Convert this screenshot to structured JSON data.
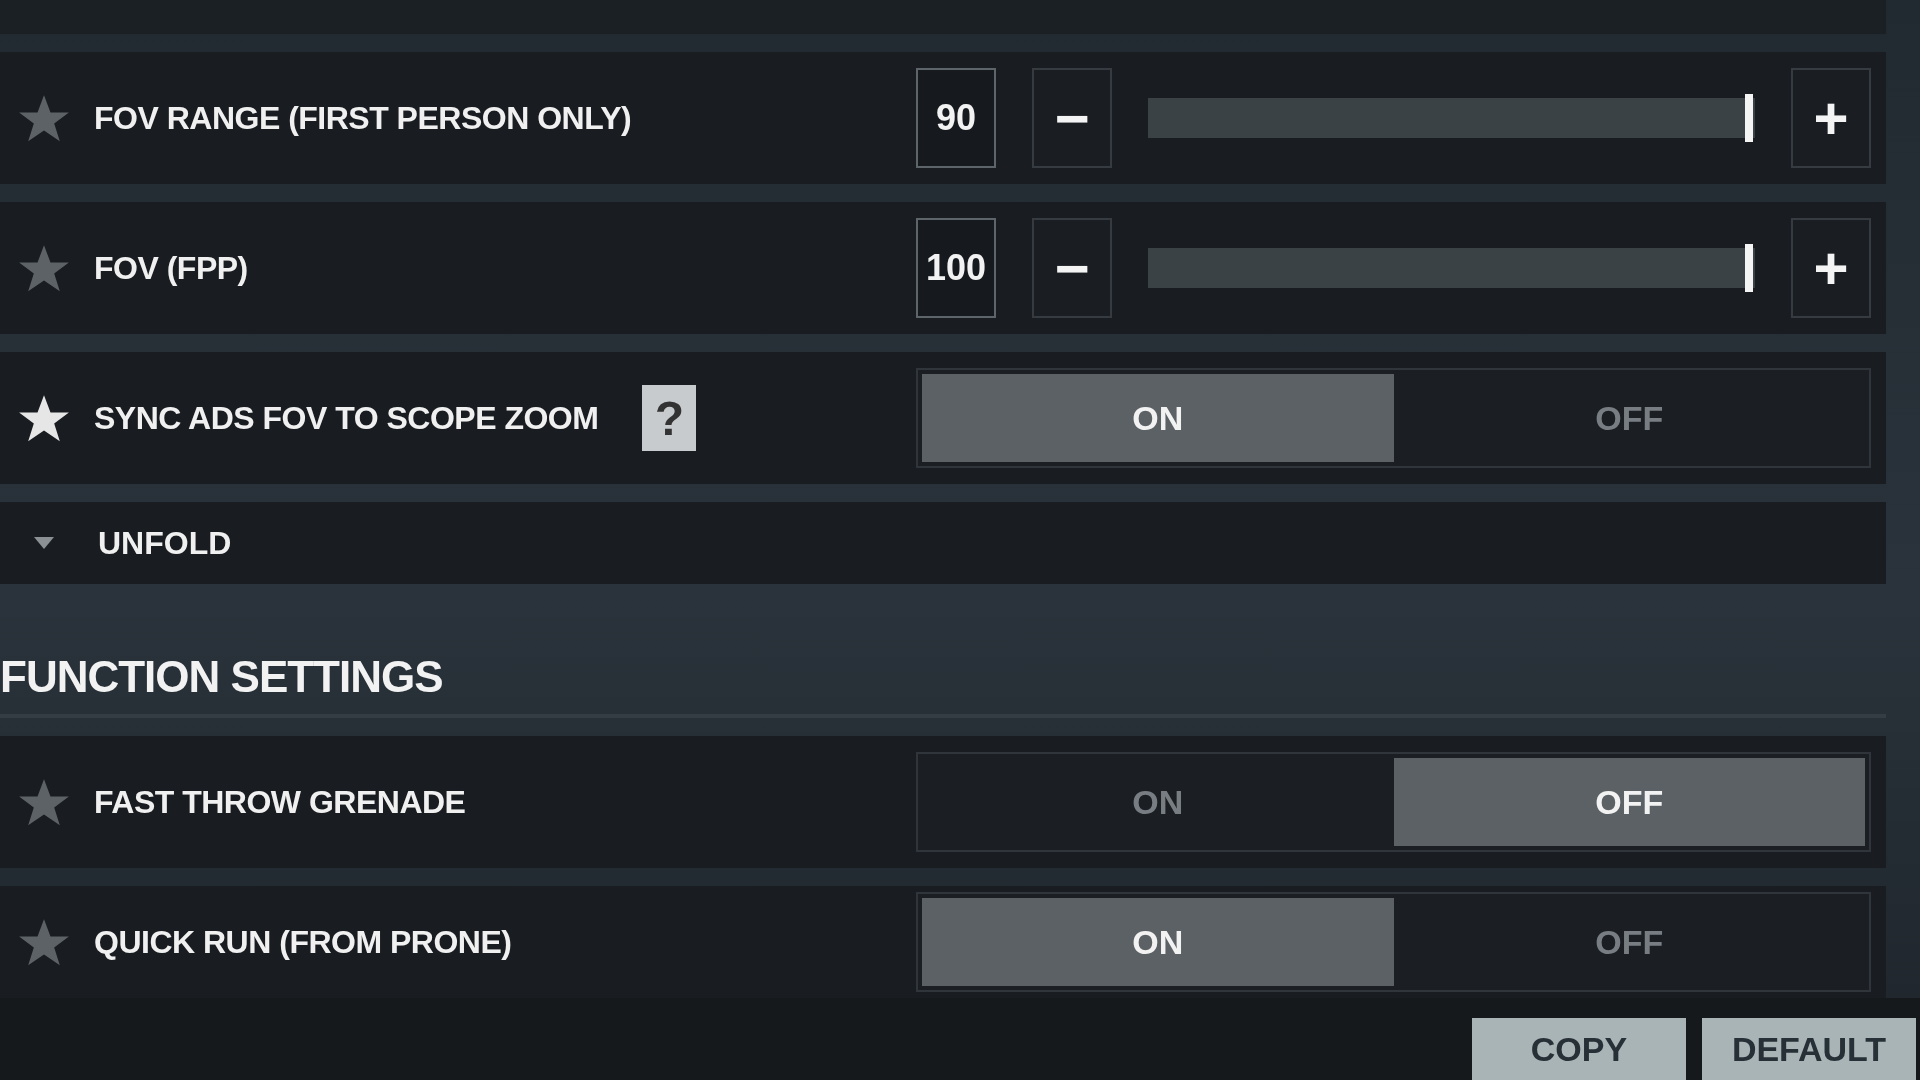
{
  "rows": [
    {
      "kind": "slider",
      "label": "FOV RANGE (FIRST PERSON ONLY)",
      "favorite": false,
      "value": "90",
      "minus": "−",
      "plus": "+",
      "level": 0.99
    },
    {
      "kind": "slider",
      "label": "FOV (FPP)",
      "favorite": false,
      "value": "100",
      "minus": "−",
      "plus": "+",
      "level": 0.99
    },
    {
      "kind": "toggle",
      "label": "SYNC ADS FOV TO SCOPE ZOOM",
      "favorite": true,
      "help": "?",
      "options": [
        {
          "label": "ON",
          "selected": true
        },
        {
          "label": "OFF",
          "selected": false
        }
      ]
    }
  ],
  "unfold": {
    "label": "UNFOLD",
    "expanded": false
  },
  "section": {
    "title": "FUNCTION SETTINGS",
    "rows": [
      {
        "kind": "toggle",
        "label": "FAST THROW GRENADE",
        "favorite": false,
        "options": [
          {
            "label": "ON",
            "selected": false
          },
          {
            "label": "OFF",
            "selected": true
          }
        ]
      },
      {
        "kind": "toggle",
        "label": "QUICK RUN (FROM PRONE)",
        "favorite": false,
        "options": [
          {
            "label": "ON",
            "selected": true
          },
          {
            "label": "OFF",
            "selected": false
          }
        ]
      }
    ]
  },
  "footer": {
    "buttons": [
      "COPY",
      "DEFAULT"
    ]
  }
}
